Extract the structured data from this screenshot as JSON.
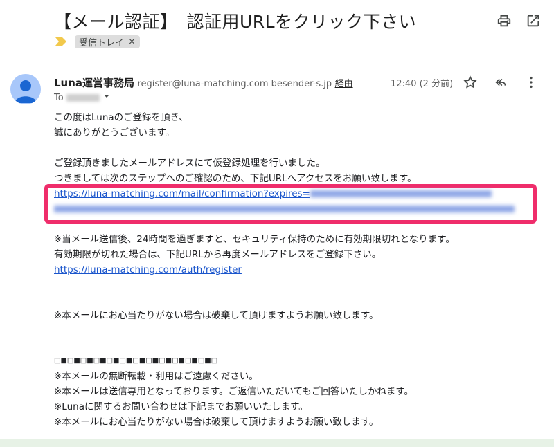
{
  "email": {
    "subject": "【メール認証】　認証用URLをクリック下さい",
    "label": "受信トレイ",
    "label_remove": "×",
    "sender_name": "Luna運営事務局",
    "sender_meta": "register@luna-matching.com besender-s.jp",
    "sender_via": "経由",
    "to_prefix": "To",
    "time": "12:40 (2 分前)",
    "body": {
      "line1": "この度はLunaのご登録を頂き、",
      "line2": "誠にありがとうございます。",
      "line3": "ご登録頂きましたメールアドレスにて仮登録処理を行いました。",
      "line4": "つきましては次のステップへのご確認のため、下記URLへアクセスをお願い致します。",
      "confirm_link": "https://luna-matching.com/mail/confirmation?expires=",
      "notice1": "※当メール送信後、24時間を過ぎますと、セキュリティ保持のために有効期限切れとなります。",
      "notice2": "有効期限が切れた場合は、下記URLから再度メールアドレスをご登録下さい。",
      "register_link": "https://luna-matching.com/auth/register",
      "notice3": "※本メールにお心当たりがない場合は破棄して頂けますようお願い致します。",
      "separator": "□■□■□■□■□■□■□■□■□■□■□■□■□",
      "footer1": "※本メールの無断転載・利用はご遠慮ください。",
      "footer2": "※本メールは送信専用となっております。ご返信いただいてもご回答いたしかねます。",
      "footer3": "※Lunaに関するお問い合わせは下記までお願いいたします。",
      "footer4": "※本メールにお心当たりがない場合は破棄して頂けますようお願い致します。"
    }
  },
  "icons": {
    "print": "print-icon",
    "open_new": "open-in-new-icon",
    "label_tag": "label-arrow-icon",
    "star": "star-icon",
    "reply": "reply-icon",
    "more": "more-vert-icon"
  },
  "colors": {
    "link": "#1a55cc",
    "highlight": "#ef2d6b",
    "label_tag": "#f2c94c",
    "avatar": "#a8c7fa"
  }
}
